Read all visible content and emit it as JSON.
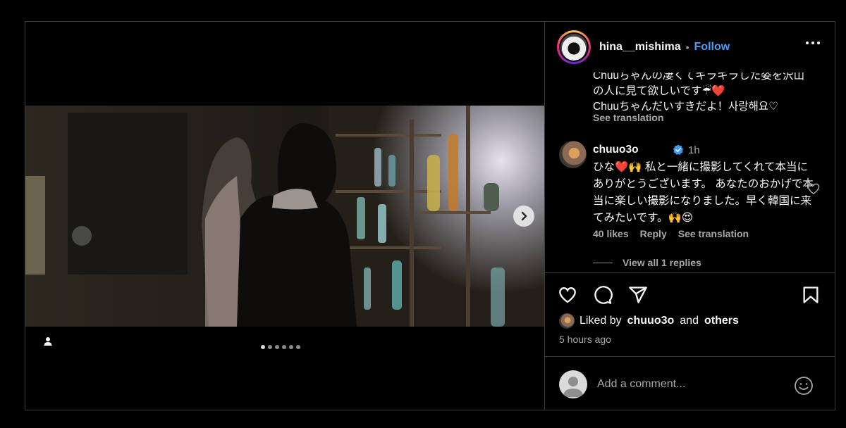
{
  "post": {
    "username": "hina__mishima",
    "separator": "•",
    "follow_label": "Follow",
    "carousel": {
      "slide_count": 6,
      "active_index": 0
    }
  },
  "caption": {
    "clipped_line": "Chuuちゃんの凄くてキラキラした姿を沢山",
    "line1": "の人に見て欲しいです☔❤️",
    "line2": "Chuuちゃんだいすきだよ！사랑해요♡",
    "see_translation": "See translation"
  },
  "comment": {
    "username": "chuuo3o",
    "time": "1h",
    "text": "ひな❤️🙌 私と一緒に撮影してくれて本当にありがとうございます。 あなたのおかげで本当に楽しい撮影になりました。早く韓国に来てみたいです。🙌😍",
    "likes": "40 likes",
    "reply_label": "Reply",
    "see_translation": "See translation",
    "view_replies": "View all 1 replies"
  },
  "likes": {
    "prefix": "Liked by",
    "user": "chuuo3o",
    "and": "and",
    "others": "others"
  },
  "posted_time": "5 hours ago",
  "comment_input": {
    "placeholder": "Add a comment..."
  },
  "icons": [
    "person-tag-icon",
    "chevron-right-icon",
    "more-icon",
    "verified-icon",
    "heart-icon",
    "comment-icon",
    "share-icon",
    "bookmark-icon",
    "emoji-icon"
  ],
  "colors": {
    "accent": "#4a9df8",
    "background": "#000000",
    "muted": "#a8a8a8"
  }
}
